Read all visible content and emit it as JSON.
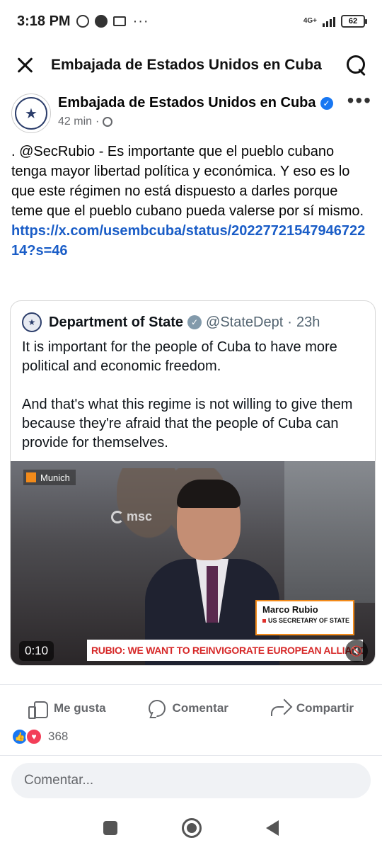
{
  "status_bar": {
    "time": "3:18 PM",
    "network": "4G+",
    "battery": "62",
    "apps": [
      "whatsapp-icon",
      "facebook-icon",
      "gmail-icon"
    ]
  },
  "header": {
    "title": "Embajada de Estados Unidos en Cuba"
  },
  "post": {
    "author": "Embajada de Estados Unidos en Cuba",
    "time": "42 min",
    "text": ". @SecRubio - Es importante que el pueblo cubano tenga mayor libertad política y económica.  Y eso es lo que este régimen no está dispuesto a darles porque teme que el pueblo cubano pueda valerse por sí mismo.",
    "link": "https://x.com/usembcuba/status/2022772154794672214?s=46"
  },
  "embedded_tweet": {
    "name": "Department of State",
    "handle": "@StateDept",
    "time": "23h",
    "text": "It is important for the people of Cuba to have more political and economic freedom.\n\nAnd that's what this regime is not willing to give them because they're afraid that the people of Cuba can provide for themselves.",
    "video": {
      "location": "Munich",
      "logo": "msc",
      "speaker_name": "Marco Rubio",
      "speaker_title": "US SECRETARY OF STATE",
      "headline": "RUBIO: WE WANT TO REINVIGORATE EUROPEAN ALLIANCE",
      "duration": "0:10"
    }
  },
  "actions": {
    "like": "Me gusta",
    "comment": "Comentar",
    "share": "Compartir"
  },
  "reactions": {
    "count": "368"
  },
  "comment_box": {
    "placeholder": "Comentar..."
  },
  "colors": {
    "link": "#1a5dc7",
    "facebook_blue": "#1877f2",
    "love_red": "#f33e58",
    "headline_red": "#d62828",
    "accent_orange": "#f28a1a"
  }
}
